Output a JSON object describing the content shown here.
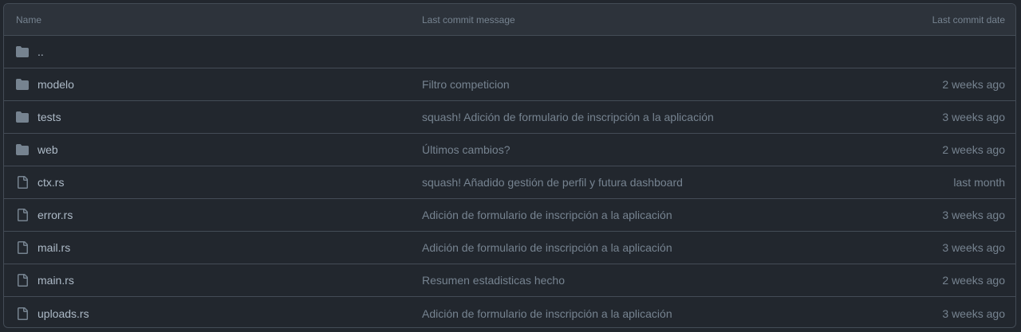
{
  "table": {
    "headers": {
      "name": "Name",
      "message": "Last commit message",
      "date": "Last commit date"
    },
    "parent": {
      "label": "..",
      "icon": "folder-icon"
    },
    "rows": [
      {
        "name": "modelo",
        "type": "dir",
        "icon": "folder-icon",
        "message": "Filtro competicion",
        "date": "2 weeks ago"
      },
      {
        "name": "tests",
        "type": "dir",
        "icon": "folder-icon",
        "message": "squash! Adición de formulario de inscripción a la aplicación",
        "date": "3 weeks ago"
      },
      {
        "name": "web",
        "type": "dir",
        "icon": "folder-icon",
        "message": "Últimos cambios?",
        "date": "2 weeks ago"
      },
      {
        "name": "ctx.rs",
        "type": "file",
        "icon": "file-icon",
        "message": "squash! Añadido gestión de perfil y futura dashboard",
        "date": "last month"
      },
      {
        "name": "error.rs",
        "type": "file",
        "icon": "file-icon",
        "message": "Adición de formulario de inscripción a la aplicación",
        "date": "3 weeks ago"
      },
      {
        "name": "mail.rs",
        "type": "file",
        "icon": "file-icon",
        "message": "Adición de formulario de inscripción a la aplicación",
        "date": "3 weeks ago"
      },
      {
        "name": "main.rs",
        "type": "file",
        "icon": "file-icon",
        "message": "Resumen estadisticas hecho",
        "date": "2 weeks ago"
      },
      {
        "name": "uploads.rs",
        "type": "file",
        "icon": "file-icon",
        "message": "Adición de formulario de inscripción a la aplicación",
        "date": "3 weeks ago"
      }
    ]
  },
  "colors": {
    "background": "#22272e",
    "header_background": "#2d333b",
    "border": "#444c56",
    "text": "#adbac7",
    "muted": "#768390",
    "icon": "#768390"
  }
}
